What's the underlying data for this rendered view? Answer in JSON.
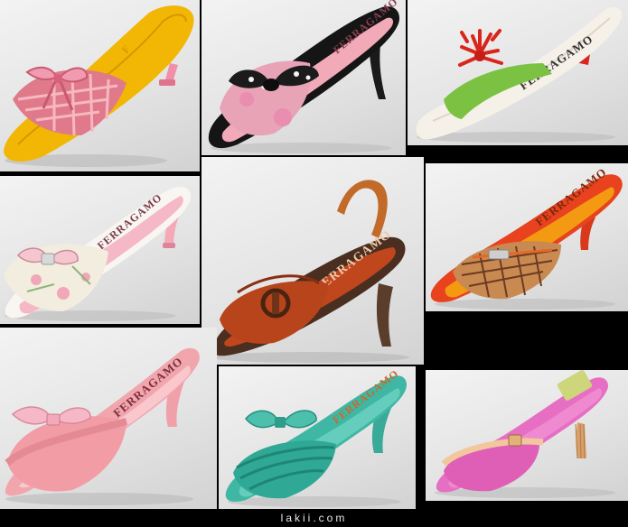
{
  "brand_text": "FERRAGAMO",
  "watermark": "lakii.com",
  "colors": {
    "background": "#000000",
    "tile_background": "#e6e6e6",
    "yellow_insole": "#f2b705",
    "pink_bow": "#e48aa0",
    "black_bow": "#1a1a1a",
    "green_strap": "#7cc242",
    "red_coral": "#d8261c",
    "light_pink": "#f4b8c6",
    "brown_leather": "#c0461e",
    "orange_insole": "#f39a12",
    "salmon_pink": "#f1a6ae",
    "turquoise": "#3fb7a4",
    "magenta": "#e66fc3"
  },
  "shoes": [
    {
      "name": "yellow-pink-kitten-heel-mule"
    },
    {
      "name": "black-polka-dot-bow-mule"
    },
    {
      "name": "white-green-coral-mule"
    },
    {
      "name": "pink-floral-bow-mule"
    },
    {
      "name": "brown-leather-slingback-sandal"
    },
    {
      "name": "orange-woven-buckle-mule"
    },
    {
      "name": "salmon-pink-bow-mule"
    },
    {
      "name": "turquoise-bow-mule"
    },
    {
      "name": "magenta-buckle-mule"
    }
  ]
}
